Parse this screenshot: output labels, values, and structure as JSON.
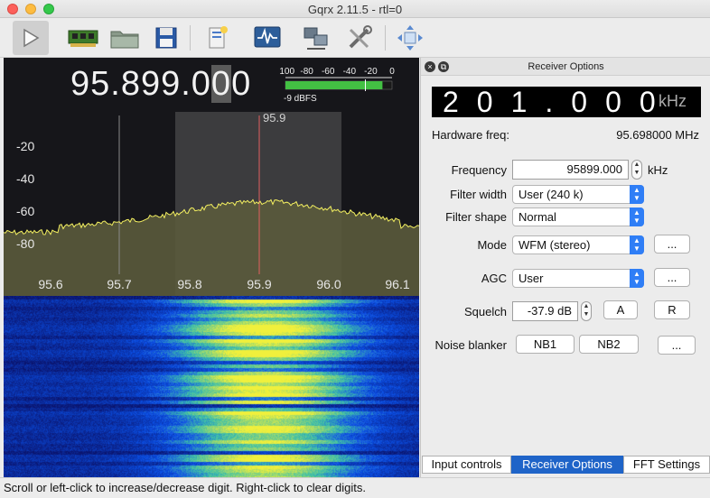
{
  "window": {
    "title": "Gqrx 2.11.5 - rtl=0"
  },
  "toolbar": {
    "buttons": [
      "play-icon",
      "hardware-card-icon",
      "open-folder-icon",
      "save-icon",
      "io-config-icon",
      "spectrum-monitor-icon",
      "network-remote-icon",
      "settings-tools-icon",
      "fullscreen-move-icon"
    ]
  },
  "frequency_display": {
    "text_main": "95.899.0",
    "text_sel": "0",
    "text_tail": "0"
  },
  "signal_meter": {
    "scale": [
      "-100",
      "-80",
      "-60",
      "-40",
      "-20",
      "0"
    ],
    "readout": "-9 dBFS",
    "level_fraction": 0.91
  },
  "fft": {
    "y_ticks": [
      "-20",
      "-40",
      "-60",
      "-80"
    ],
    "x_ticks": [
      "95.6",
      "95.7",
      "95.8",
      "95.9",
      "96.0",
      "96.1"
    ],
    "marker_label": "95.9"
  },
  "receiver_panel": {
    "title": "Receiver Options",
    "offset_digits": "201.000",
    "offset_unit": "kHz",
    "hardware_freq_label": "Hardware freq:",
    "hardware_freq_value": "95.698000 MHz",
    "frequency_label": "Frequency",
    "frequency_value": "95899.000",
    "frequency_unit": "kHz",
    "filter_width_label": "Filter width",
    "filter_width_value": "User (240 k)",
    "filter_shape_label": "Filter shape",
    "filter_shape_value": "Normal",
    "mode_label": "Mode",
    "mode_value": "WFM (stereo)",
    "mode_more": "...",
    "agc_label": "AGC",
    "agc_value": "User",
    "agc_more": "...",
    "squelch_label": "Squelch",
    "squelch_value": "-37.9 dB",
    "squelch_a": "A",
    "squelch_r": "R",
    "noise_blanker_label": "Noise blanker",
    "nb1": "NB1",
    "nb2": "NB2",
    "nb_more": "..."
  },
  "tabs": [
    {
      "label": "Input controls",
      "active": false
    },
    {
      "label": "Receiver Options",
      "active": true
    },
    {
      "label": "FFT Settings",
      "active": false
    }
  ],
  "status": {
    "text": "Scroll or left-click to increase/decrease digit. Right-click to clear digits."
  },
  "colors": {
    "accent": "#1f64c8",
    "fft_trace": "#f4f060",
    "center_line": "#e06060",
    "meter_green": "#43c043"
  }
}
